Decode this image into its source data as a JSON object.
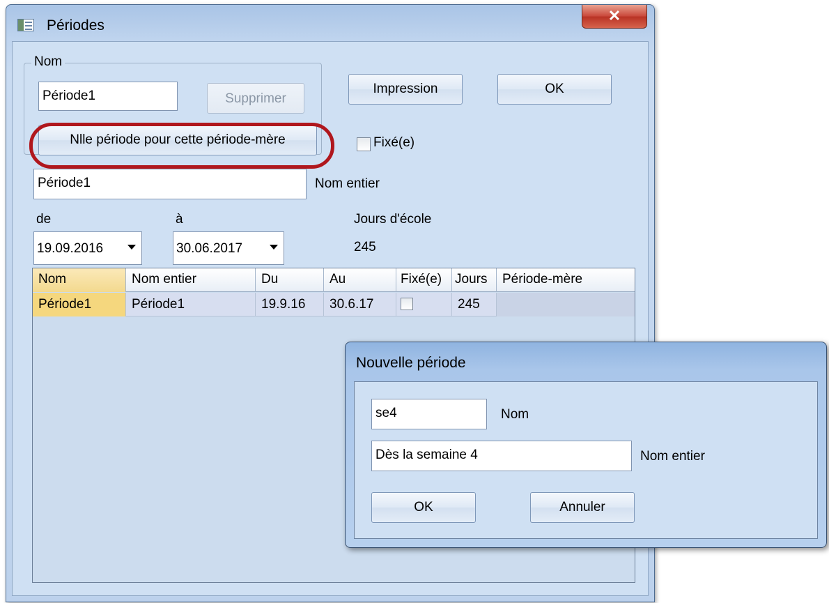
{
  "main_window": {
    "title": "Périodes",
    "close_glyph": "✕",
    "nom_group": {
      "legend": "Nom",
      "name_value": "Période1",
      "delete_label": "Supprimer",
      "new_sub_period_label": "Nlle période pour cette période-mère"
    },
    "print_label": "Impression",
    "ok_label": "OK",
    "fixed_label": "Fixé(e)",
    "full_name_value": "Période1",
    "full_name_label": "Nom entier",
    "from_label": "de",
    "to_label": "à",
    "school_days_label": "Jours d'école",
    "from_value": "19.09.2016",
    "to_value": "30.06.2017",
    "school_days_value": "245"
  },
  "grid": {
    "columns": [
      "Nom",
      "Nom entier",
      "Du",
      "Au",
      "Fixé(e)",
      "Jours",
      "Période-mère"
    ],
    "rows": [
      {
        "nom": "Période1",
        "nom_entier": "Période1",
        "du": "19.9.16",
        "au": "30.6.17",
        "fixe": false,
        "jours": "245",
        "periode_mere": ""
      }
    ]
  },
  "dialog": {
    "title": "Nouvelle période",
    "name_value": "se4",
    "name_label": "Nom",
    "full_name_value": "Dès la semaine 4",
    "full_name_label": "Nom entier",
    "ok_label": "OK",
    "cancel_label": "Annuler"
  },
  "colors": {
    "highlight_ring": "#b0171d",
    "selected_cell": "#f5d77e",
    "title_bar": "#a9c4e6"
  },
  "icons": [
    "app-window-icon",
    "close-icon",
    "dropdown-arrow-icon",
    "checkbox"
  ]
}
